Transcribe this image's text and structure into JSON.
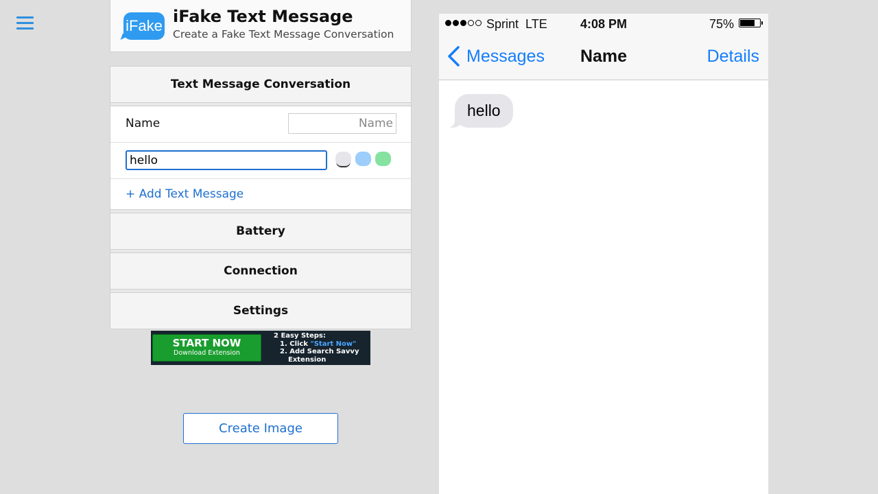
{
  "menu": {
    "icon": "hamburger-menu-icon"
  },
  "header": {
    "logo_text": "iFake",
    "title": "iFake Text Message",
    "subtitle": "Create a Fake Text Message Conversation"
  },
  "conversation": {
    "heading": "Text Message Conversation",
    "name_label": "Name",
    "name_placeholder": "Name",
    "name_value": "",
    "message_value": "hello",
    "bubble_colors": [
      "#e5e5ea",
      "#9dcdfa",
      "#85e2a0"
    ],
    "add_message": "+ Add Text Message"
  },
  "sections": [
    {
      "label": "Battery"
    },
    {
      "label": "Connection"
    },
    {
      "label": "Settings"
    }
  ],
  "ad": {
    "button_title": "START NOW",
    "button_sub": "Download Extension",
    "steps_title": "2 Easy Steps:",
    "step1_prefix": "1. Click ",
    "step1_link": "\"Start Now\"",
    "step2_line1": "2. Add Search Savvy",
    "step2_line2": "Extension"
  },
  "create_button": "Create Image",
  "phone": {
    "status": {
      "signal_dots_full": 3,
      "signal_dots_total": 5,
      "carrier": "Sprint  LTE",
      "time": "4:08 PM",
      "battery_percent": "75%",
      "battery_level": 0.75
    },
    "nav": {
      "back_label": "Messages",
      "title": "Name",
      "right_label": "Details"
    },
    "messages": [
      {
        "text": "hello",
        "type": "received"
      }
    ]
  },
  "colors": {
    "ios_blue": "#147efb",
    "link_blue": "#1e6fcf",
    "bubble_gray": "#e5e5ea"
  }
}
